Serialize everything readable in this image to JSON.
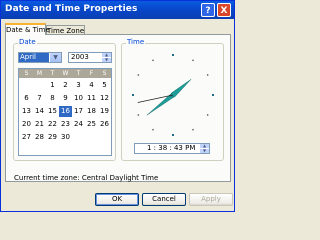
{
  "window": {
    "title": "Date and Time Properties",
    "help_label": "?",
    "close_label": "X"
  },
  "tabs": [
    {
      "label": "Date & Time",
      "active": true
    },
    {
      "label": "Time Zone",
      "active": false
    }
  ],
  "date": {
    "group_label": "Date",
    "month": "April",
    "year": "2003",
    "weekday_headers": [
      "S",
      "M",
      "T",
      "W",
      "T",
      "F",
      "S"
    ],
    "weeks": [
      [
        "",
        "",
        "1",
        "2",
        "3",
        "4",
        "5"
      ],
      [
        "6",
        "7",
        "8",
        "9",
        "10",
        "11",
        "12"
      ],
      [
        "13",
        "14",
        "15",
        "16",
        "17",
        "18",
        "19"
      ],
      [
        "20",
        "21",
        "22",
        "23",
        "24",
        "25",
        "26"
      ],
      [
        "27",
        "28",
        "29",
        "30",
        "",
        "",
        ""
      ]
    ],
    "selected_day": "16"
  },
  "time": {
    "group_label": "Time",
    "value": "1 : 38 : 43 PM",
    "clock": {
      "hour": 1,
      "minute": 38,
      "second": 43
    }
  },
  "status": {
    "label": "Current time zone:",
    "value": "Central Daylight Time"
  },
  "buttons": {
    "ok": "OK",
    "cancel": "Cancel",
    "apply": "Apply"
  },
  "colors": {
    "accent": "#316AC5",
    "group_label": "#0046D5",
    "hand": "#1E9E9A"
  }
}
